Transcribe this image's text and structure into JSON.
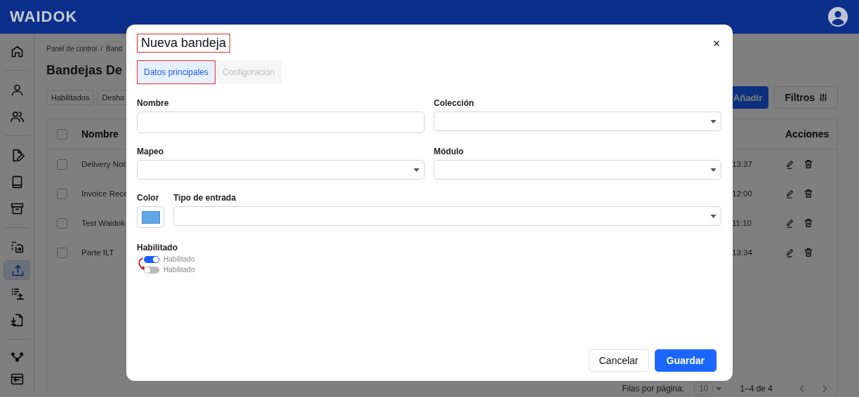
{
  "header": {
    "logo": "WAIDOK"
  },
  "sidebar": {
    "groups": [
      [
        {
          "kind": "home",
          "selected": false
        }
      ],
      [
        {
          "kind": "user",
          "selected": false
        },
        {
          "kind": "users",
          "selected": false
        }
      ],
      [
        {
          "kind": "file-pen",
          "selected": false
        },
        {
          "kind": "book",
          "selected": false
        },
        {
          "kind": "archive",
          "selected": false
        }
      ],
      [
        {
          "kind": "transfer",
          "selected": false
        },
        {
          "kind": "upload",
          "selected": true
        },
        {
          "kind": "list-upload",
          "selected": false
        },
        {
          "kind": "download",
          "selected": false
        }
      ],
      [
        {
          "kind": "branch",
          "selected": false
        },
        {
          "kind": "window",
          "selected": false
        }
      ]
    ]
  },
  "breadcrumb": {
    "items": [
      "Panel de control",
      "Band"
    ],
    "separator": "/"
  },
  "page_title": "Bandejas De",
  "filter_chips": [
    "Habilitados",
    "Desha"
  ],
  "actions": {
    "add": "Añadir",
    "filters": "Filtros"
  },
  "table": {
    "header": {
      "checked": false,
      "name": "Nombre",
      "actions": "Acciones"
    },
    "rows": [
      {
        "checked": false,
        "name": "Delivery Not",
        "time": "13:37"
      },
      {
        "checked": false,
        "name": "Invoice Rece",
        "time": "12:00"
      },
      {
        "checked": false,
        "name": "Test Waidok",
        "time": "11:10"
      },
      {
        "checked": false,
        "name": "Parte ILT",
        "time": "13:34"
      }
    ]
  },
  "pagination": {
    "rows_per_page_label": "Filas por página:",
    "rows_per_page": "10",
    "range": "1–4 de 4"
  },
  "dialog": {
    "title": "Nueva bandeja",
    "title_highlighted": true,
    "tabs": [
      {
        "label": "Datos principales",
        "selected": true,
        "highlighted": true
      },
      {
        "label": "Configuración",
        "selected": false,
        "highlighted": false
      }
    ],
    "rows": [
      [
        {
          "label": "Nombre",
          "kind": "text"
        },
        {
          "label": "Colección",
          "kind": "select"
        }
      ],
      [
        {
          "label": "Mapeo",
          "kind": "select"
        },
        {
          "label": "Módulo",
          "kind": "select"
        }
      ],
      [
        {
          "label": "Color",
          "kind": "color"
        },
        {
          "label": "Tipo de entrada",
          "kind": "select"
        }
      ]
    ],
    "switch_group": {
      "label": "Habilitado",
      "arrow": true,
      "switches": [
        {
          "label": "Habilitado",
          "on": true
        },
        {
          "label": "Habilitado",
          "on": false
        }
      ]
    },
    "buttons": {
      "cancel": "Cancelar",
      "save": "Guardar"
    }
  }
}
